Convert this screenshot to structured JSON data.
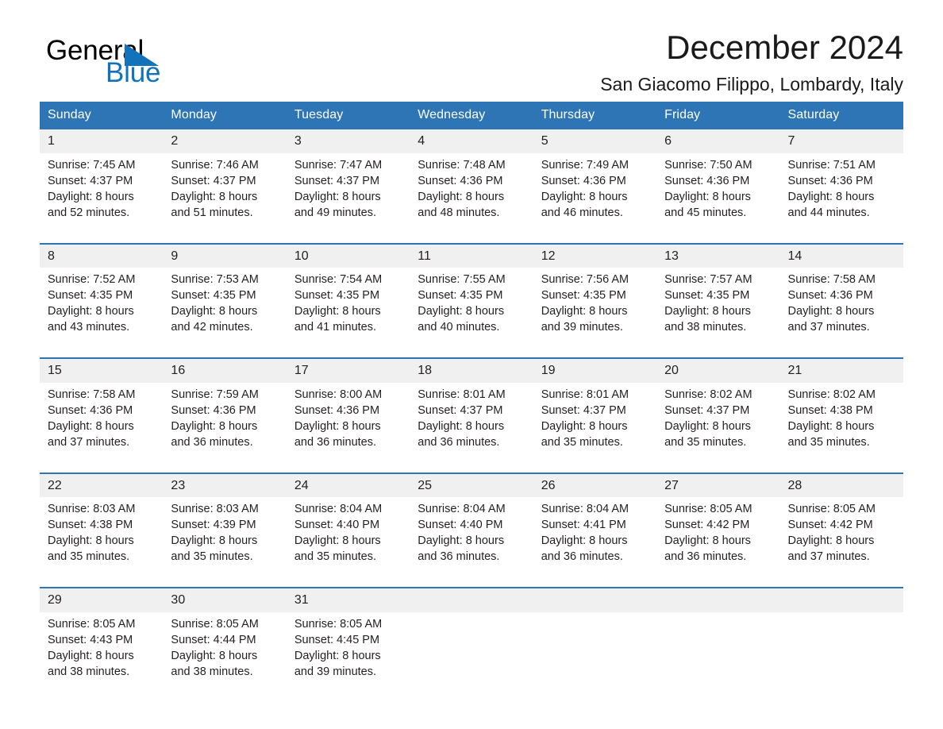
{
  "brand": {
    "name_part1": "General",
    "name_part2": "Blue",
    "accent_color": "#1272bb"
  },
  "header": {
    "title": "December 2024",
    "location": "San Giacomo Filippo, Lombardy, Italy"
  },
  "theme": {
    "header_bar_color": "#2e75b6",
    "date_band_color": "#f0f0f0",
    "separator_color": "#2e75b6"
  },
  "calendar": {
    "weekday_headers": [
      "Sunday",
      "Monday",
      "Tuesday",
      "Wednesday",
      "Thursday",
      "Friday",
      "Saturday"
    ],
    "weeks": [
      [
        {
          "day": "1",
          "text": "Sunrise: 7:45 AM\nSunset: 4:37 PM\nDaylight: 8 hours\nand 52 minutes."
        },
        {
          "day": "2",
          "text": "Sunrise: 7:46 AM\nSunset: 4:37 PM\nDaylight: 8 hours\nand 51 minutes."
        },
        {
          "day": "3",
          "text": "Sunrise: 7:47 AM\nSunset: 4:37 PM\nDaylight: 8 hours\nand 49 minutes."
        },
        {
          "day": "4",
          "text": "Sunrise: 7:48 AM\nSunset: 4:36 PM\nDaylight: 8 hours\nand 48 minutes."
        },
        {
          "day": "5",
          "text": "Sunrise: 7:49 AM\nSunset: 4:36 PM\nDaylight: 8 hours\nand 46 minutes."
        },
        {
          "day": "6",
          "text": "Sunrise: 7:50 AM\nSunset: 4:36 PM\nDaylight: 8 hours\nand 45 minutes."
        },
        {
          "day": "7",
          "text": "Sunrise: 7:51 AM\nSunset: 4:36 PM\nDaylight: 8 hours\nand 44 minutes."
        }
      ],
      [
        {
          "day": "8",
          "text": "Sunrise: 7:52 AM\nSunset: 4:35 PM\nDaylight: 8 hours\nand 43 minutes."
        },
        {
          "day": "9",
          "text": "Sunrise: 7:53 AM\nSunset: 4:35 PM\nDaylight: 8 hours\nand 42 minutes."
        },
        {
          "day": "10",
          "text": "Sunrise: 7:54 AM\nSunset: 4:35 PM\nDaylight: 8 hours\nand 41 minutes."
        },
        {
          "day": "11",
          "text": "Sunrise: 7:55 AM\nSunset: 4:35 PM\nDaylight: 8 hours\nand 40 minutes."
        },
        {
          "day": "12",
          "text": "Sunrise: 7:56 AM\nSunset: 4:35 PM\nDaylight: 8 hours\nand 39 minutes."
        },
        {
          "day": "13",
          "text": "Sunrise: 7:57 AM\nSunset: 4:35 PM\nDaylight: 8 hours\nand 38 minutes."
        },
        {
          "day": "14",
          "text": "Sunrise: 7:58 AM\nSunset: 4:36 PM\nDaylight: 8 hours\nand 37 minutes."
        }
      ],
      [
        {
          "day": "15",
          "text": "Sunrise: 7:58 AM\nSunset: 4:36 PM\nDaylight: 8 hours\nand 37 minutes."
        },
        {
          "day": "16",
          "text": "Sunrise: 7:59 AM\nSunset: 4:36 PM\nDaylight: 8 hours\nand 36 minutes."
        },
        {
          "day": "17",
          "text": "Sunrise: 8:00 AM\nSunset: 4:36 PM\nDaylight: 8 hours\nand 36 minutes."
        },
        {
          "day": "18",
          "text": "Sunrise: 8:01 AM\nSunset: 4:37 PM\nDaylight: 8 hours\nand 36 minutes."
        },
        {
          "day": "19",
          "text": "Sunrise: 8:01 AM\nSunset: 4:37 PM\nDaylight: 8 hours\nand 35 minutes."
        },
        {
          "day": "20",
          "text": "Sunrise: 8:02 AM\nSunset: 4:37 PM\nDaylight: 8 hours\nand 35 minutes."
        },
        {
          "day": "21",
          "text": "Sunrise: 8:02 AM\nSunset: 4:38 PM\nDaylight: 8 hours\nand 35 minutes."
        }
      ],
      [
        {
          "day": "22",
          "text": "Sunrise: 8:03 AM\nSunset: 4:38 PM\nDaylight: 8 hours\nand 35 minutes."
        },
        {
          "day": "23",
          "text": "Sunrise: 8:03 AM\nSunset: 4:39 PM\nDaylight: 8 hours\nand 35 minutes."
        },
        {
          "day": "24",
          "text": "Sunrise: 8:04 AM\nSunset: 4:40 PM\nDaylight: 8 hours\nand 35 minutes."
        },
        {
          "day": "25",
          "text": "Sunrise: 8:04 AM\nSunset: 4:40 PM\nDaylight: 8 hours\nand 36 minutes."
        },
        {
          "day": "26",
          "text": "Sunrise: 8:04 AM\nSunset: 4:41 PM\nDaylight: 8 hours\nand 36 minutes."
        },
        {
          "day": "27",
          "text": "Sunrise: 8:05 AM\nSunset: 4:42 PM\nDaylight: 8 hours\nand 36 minutes."
        },
        {
          "day": "28",
          "text": "Sunrise: 8:05 AM\nSunset: 4:42 PM\nDaylight: 8 hours\nand 37 minutes."
        }
      ],
      [
        {
          "day": "29",
          "text": "Sunrise: 8:05 AM\nSunset: 4:43 PM\nDaylight: 8 hours\nand 38 minutes."
        },
        {
          "day": "30",
          "text": "Sunrise: 8:05 AM\nSunset: 4:44 PM\nDaylight: 8 hours\nand 38 minutes."
        },
        {
          "day": "31",
          "text": "Sunrise: 8:05 AM\nSunset: 4:45 PM\nDaylight: 8 hours\nand 39 minutes."
        },
        {
          "day": "",
          "text": ""
        },
        {
          "day": "",
          "text": ""
        },
        {
          "day": "",
          "text": ""
        },
        {
          "day": "",
          "text": ""
        }
      ]
    ]
  }
}
